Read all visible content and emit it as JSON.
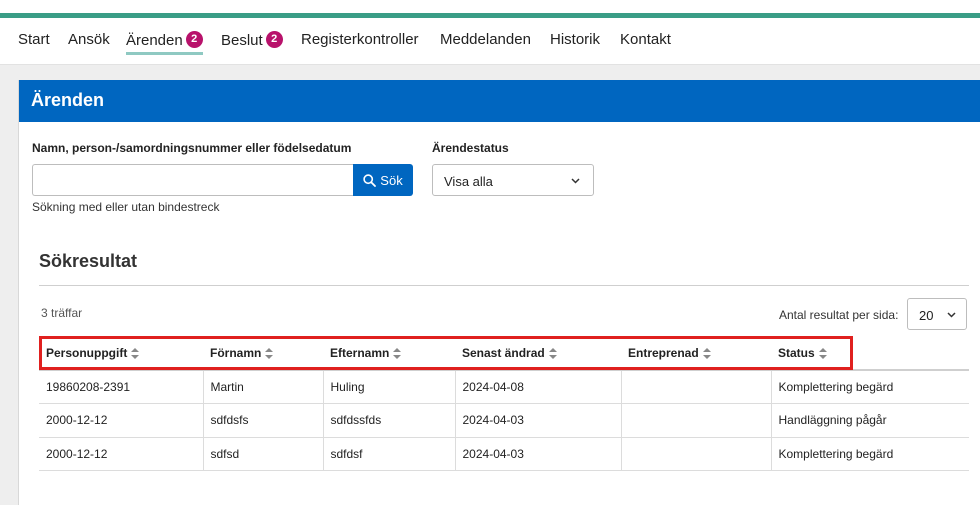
{
  "nav": {
    "items": [
      {
        "label": "Start"
      },
      {
        "label": "Ansök"
      },
      {
        "label": "Ärenden",
        "badge": "2",
        "active": true
      },
      {
        "label": "Beslut",
        "badge": "2"
      },
      {
        "label": "Registerkontroller"
      },
      {
        "label": "Meddelanden"
      },
      {
        "label": "Historik"
      },
      {
        "label": "Kontakt"
      }
    ]
  },
  "panel": {
    "title": "Ärenden"
  },
  "search": {
    "label": "Namn, person-/samordningsnummer eller födelsedatum",
    "value": "",
    "button_label": "Sök",
    "hint": "Sökning med eller utan bindestreck"
  },
  "status_filter": {
    "label": "Ärendestatus",
    "selected": "Visa alla"
  },
  "results": {
    "title": "Sökresultat",
    "hits": "3 träffar",
    "per_page_label": "Antal resultat per sida:",
    "per_page_value": "20",
    "columns": [
      "Personuppgift",
      "Förnamn",
      "Efternamn",
      "Senast ändrad",
      "Entreprenad",
      "Status"
    ],
    "rows": [
      [
        "19860208-2391",
        "Martin",
        "Huling",
        "2024-04-08",
        "",
        "Komplettering begärd"
      ],
      [
        "2000-12-12",
        "sdfdsfs",
        "sdfdssfds",
        "2024-04-03",
        "",
        "Handläggning pågår"
      ],
      [
        "2000-12-12",
        "sdfsd",
        "sdfdsf",
        "2024-04-03",
        "",
        "Komplettering begärd"
      ]
    ]
  },
  "colors": {
    "accent": "#0066c0",
    "badge": "#b8126b",
    "topline": "#3a9d86",
    "highlight": "#e0201f"
  }
}
